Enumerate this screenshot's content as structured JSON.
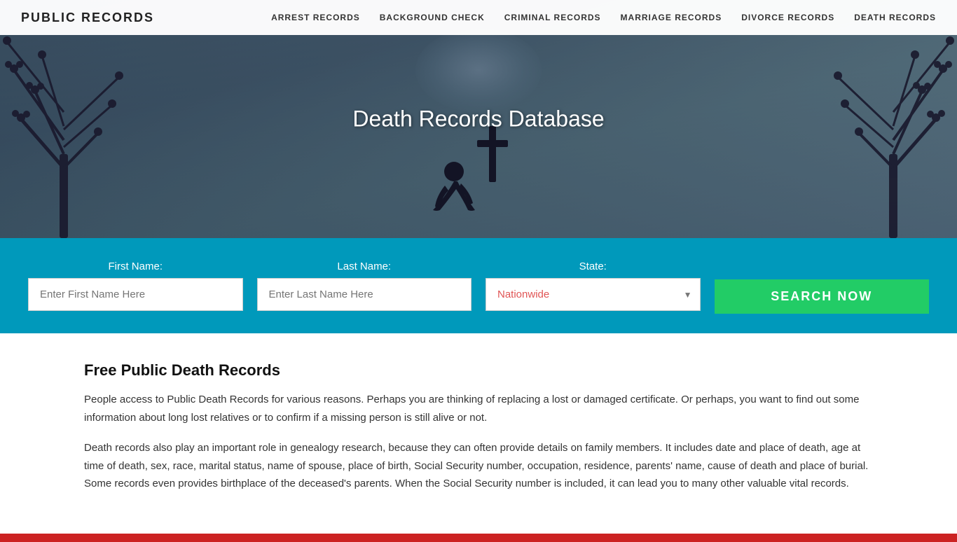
{
  "navbar": {
    "brand": "PUBLIC RECORDS",
    "links": [
      {
        "id": "arrest-records",
        "label": "ARREST RECORDS"
      },
      {
        "id": "background-check",
        "label": "BACKGROUND CHECK"
      },
      {
        "id": "criminal-records",
        "label": "CRIMINAL RECORDS"
      },
      {
        "id": "marriage-records",
        "label": "MARRIAGE RECORDS"
      },
      {
        "id": "divorce-records",
        "label": "DIVORCE RECORDS"
      },
      {
        "id": "death-records",
        "label": "DEATH RECORDS"
      }
    ]
  },
  "hero": {
    "title": "Death Records Database"
  },
  "search": {
    "first_name_label": "First Name:",
    "last_name_label": "Last Name:",
    "state_label": "State:",
    "first_name_placeholder": "Enter First Name Here",
    "last_name_placeholder": "Enter Last Name Here",
    "state_default": "Nationwide",
    "button_label": "SEARCH NOW"
  },
  "content": {
    "heading": "Free Public Death Records",
    "paragraph1": "People access to Public Death Records for various reasons. Perhaps you are thinking of replacing a lost or damaged certificate. Or perhaps, you want to find out some information about long lost relatives or to confirm if a missing person is still alive or not.",
    "paragraph2": "Death records also play an important role in genealogy research, because they can often provide details on family members. It includes date and place of death, age at time of death, sex, race, marital status, name of spouse, place of birth, Social Security number, occupation, residence, parents' name, cause of death and place of burial. Some records even provides birthplace of the deceased's parents. When the Social Security number is included, it can lead you to many other valuable vital records."
  }
}
